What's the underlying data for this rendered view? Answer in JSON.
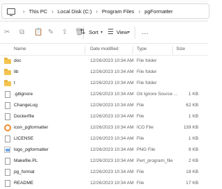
{
  "address": {
    "crumbs": [
      "This PC",
      "Local Disk (C:)",
      "Program Files",
      "pgFormatter"
    ]
  },
  "toolbar": {
    "sort_label": "Sort",
    "view_label": "View",
    "more_label": "…"
  },
  "columns": {
    "name": "Name",
    "date": "Date modified",
    "type": "Type",
    "size": "Size"
  },
  "files": [
    {
      "name": "doc",
      "date": "12/26/2023 10:34 AM",
      "type": "File folder",
      "size": "",
      "icon": "folder-icon"
    },
    {
      "name": "lib",
      "date": "12/26/2023 10:34 AM",
      "type": "File folder",
      "size": "",
      "icon": "folder-icon"
    },
    {
      "name": "t",
      "date": "12/26/2023 10:34 AM",
      "type": "File folder",
      "size": "",
      "icon": "folder-icon"
    },
    {
      "name": ".gitignore",
      "date": "12/26/2023 10:34 AM",
      "type": "Git Ignore Source ...",
      "size": "1 KB",
      "icon": "file-icon"
    },
    {
      "name": "ChangeLog",
      "date": "12/26/2023 10:34 AM",
      "type": "File",
      "size": "62 KB",
      "icon": "file-icon"
    },
    {
      "name": "Dockerfile",
      "date": "12/26/2023 10:34 AM",
      "type": "File",
      "size": "1 KB",
      "icon": "file-icon"
    },
    {
      "name": "icon_pgformatter",
      "date": "12/26/2023 10:34 AM",
      "type": "ICO File",
      "size": "139 KB",
      "icon": "ico-file-icon"
    },
    {
      "name": "LICENSE",
      "date": "12/26/2023 10:34 AM",
      "type": "File",
      "size": "1 KB",
      "icon": "file-icon"
    },
    {
      "name": "logo_pgformatter",
      "date": "12/26/2023 10:34 AM",
      "type": "PNG File",
      "size": "9 KB",
      "icon": "png-file-icon"
    },
    {
      "name": "Makefile.PL",
      "date": "12/26/2023 10:34 AM",
      "type": "Perl_program_file",
      "size": "2 KB",
      "icon": "file-icon"
    },
    {
      "name": "pg_format",
      "date": "12/26/2023 10:34 AM",
      "type": "File",
      "size": "18 KB",
      "icon": "file-icon"
    },
    {
      "name": "README",
      "date": "12/26/2023 10:34 AM",
      "type": "File",
      "size": "17 KB",
      "icon": "file-icon"
    }
  ]
}
